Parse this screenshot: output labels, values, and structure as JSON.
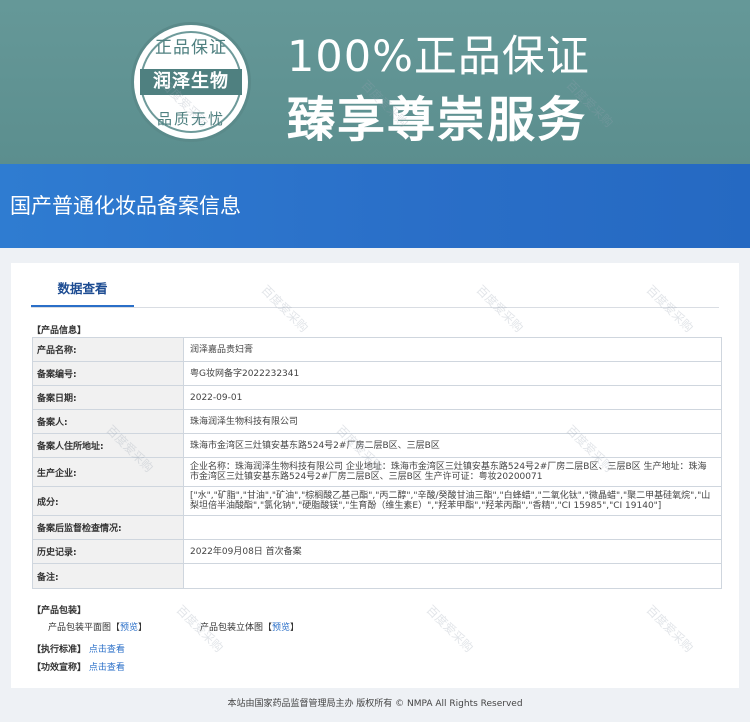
{
  "hero": {
    "seal_top": "正品保证",
    "seal_middle": "润泽生物",
    "seal_bottom": "品质无忧",
    "line1": "100%正品保证",
    "line2": "臻享尊崇服务",
    "bg_color": "#5f9494"
  },
  "banner": {
    "title": "国产普通化妆品备案信息",
    "color": "#2a6fc8"
  },
  "tab": {
    "label": "数据查看"
  },
  "product_info": {
    "section_title": "【产品信息】",
    "rows": [
      {
        "label": "产品名称:",
        "value": "润泽嘉品贵妇膏"
      },
      {
        "label": "备案编号:",
        "value": "粤G妆网备字2022232341"
      },
      {
        "label": "备案日期:",
        "value": "2022-09-01"
      },
      {
        "label": "备案人:",
        "value": "珠海润泽生物科技有限公司"
      },
      {
        "label": "备案人住所地址:",
        "value": "珠海市金湾区三灶镇安基东路524号2#厂房二层B区、三层B区"
      },
      {
        "label": "生产企业:",
        "value": "企业名称：珠海润泽生物科技有限公司 企业地址：珠海市金湾区三灶镇安基东路524号2#厂房二层B区、三层B区 生产地址：珠海市金湾区三灶镇安基东路524号2#厂房二层B区、三层B区 生产许可证：粤妆20200071"
      },
      {
        "label": "成分:",
        "value": "[\"水\",\"矿脂\",\"甘油\",\"矿油\",\"棕榈酸乙基己酯\",\"丙二醇\",\"辛酸/癸酸甘油三酯\",\"白蜂蜡\",\"二氧化钛\",\"微晶蜡\",\"聚二甲基硅氧烷\",\"山梨坦倍半油酸酯\",\"氯化钠\",\"硬脂酸镁\",\"生育酚（维生素E）\",\"羟苯甲酯\",\"羟苯丙酯\",\"香精\",\"CI 15985\",\"CI 19140\"]"
      },
      {
        "label": "备案后监督检查情况:",
        "value": ""
      },
      {
        "label": "历史记录:",
        "value": "2022年09月08日 首次备案"
      },
      {
        "label": "备注:",
        "value": ""
      }
    ]
  },
  "packaging": {
    "section_title": "【产品包装】",
    "flat_label": "产品包装平面图",
    "flat_bracket_open": "【",
    "flat_link": "预览",
    "flat_bracket_close": "】",
    "solid_label": "产品包装立体图",
    "solid_bracket_open": "【",
    "solid_link": "预览",
    "solid_bracket_close": "】"
  },
  "standard": {
    "section_title": "【执行标准】",
    "link": "点击查看"
  },
  "efficacy": {
    "section_title": "【功效宣称】",
    "link": "点击查看"
  },
  "footer": {
    "text": "本站由国家药品监督管理局主办 版权所有 © NMPA All Rights Reserved"
  },
  "watermark": {
    "text": "百度爱采购"
  }
}
